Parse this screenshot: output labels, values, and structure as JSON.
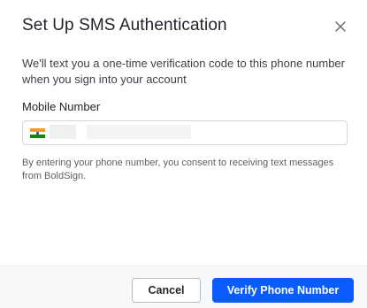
{
  "dialog": {
    "title": "Set Up SMS Authentication",
    "description": "We'll text you a one-time verification code to this phone number when you sign into your account",
    "phone_label": "Mobile Number",
    "phone_value": "",
    "country_flag": "india-flag-icon",
    "consent": "By entering your phone number, you consent to receiving text messages from BoldSign.",
    "close_icon": "close-icon"
  },
  "footer": {
    "cancel_label": "Cancel",
    "verify_label": "Verify Phone Number"
  },
  "colors": {
    "primary": "#0b5cff",
    "footer_bg": "#f7f8fa",
    "border": "#d3d6db"
  }
}
